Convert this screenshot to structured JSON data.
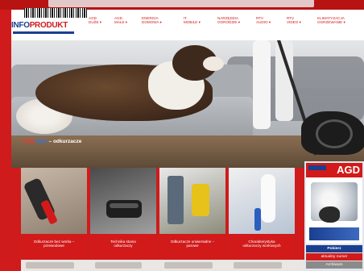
{
  "site": {
    "logo_prefix": "INFO",
    "logo_suffix": "PRODUKT"
  },
  "nav": [
    {
      "label": "AGD",
      "sub": "DUŻE ▾"
    },
    {
      "label": "AGD",
      "sub": "MAŁE ▾"
    },
    {
      "label": "ENERGIA",
      "sub": "DOMOWA ▾"
    },
    {
      "label": "IT",
      "sub": "MOBILE ▾"
    },
    {
      "label": "NARZĘDZIA",
      "sub": "OGRODZIE ▾"
    },
    {
      "label": "RTV",
      "sub": "AUDIO ▾"
    },
    {
      "label": "RTV",
      "sub": "VIDEO ▾"
    },
    {
      "label": "KLIMATYZACJA",
      "sub": "OGRZEWANIE ▾"
    }
  ],
  "hero": {
    "caption_red": "AGD",
    "caption_blue": "Małe",
    "caption_rest": " – odkurzacze"
  },
  "tiles": [
    {
      "label_1": "Odkurzacze bez worka –",
      "label_2": "przewodowe"
    },
    {
      "label_1": "Technika stania",
      "label_2": "odkurzaczy"
    },
    {
      "label_1": "Odkurzacze uniwersalne –",
      "label_2": "parowe"
    },
    {
      "label_1": "Charakterystyka",
      "label_2": "odkurzaczy workowych"
    }
  ],
  "sidebar": {
    "magazine_title": "AGD",
    "btn_primary": "Pobierz",
    "btn_secondary": "aktualny numer",
    "btn_tertiary": "Archiwum"
  },
  "colors": {
    "brand_red": "#d21a1a",
    "brand_blue": "#1a3f8f"
  }
}
